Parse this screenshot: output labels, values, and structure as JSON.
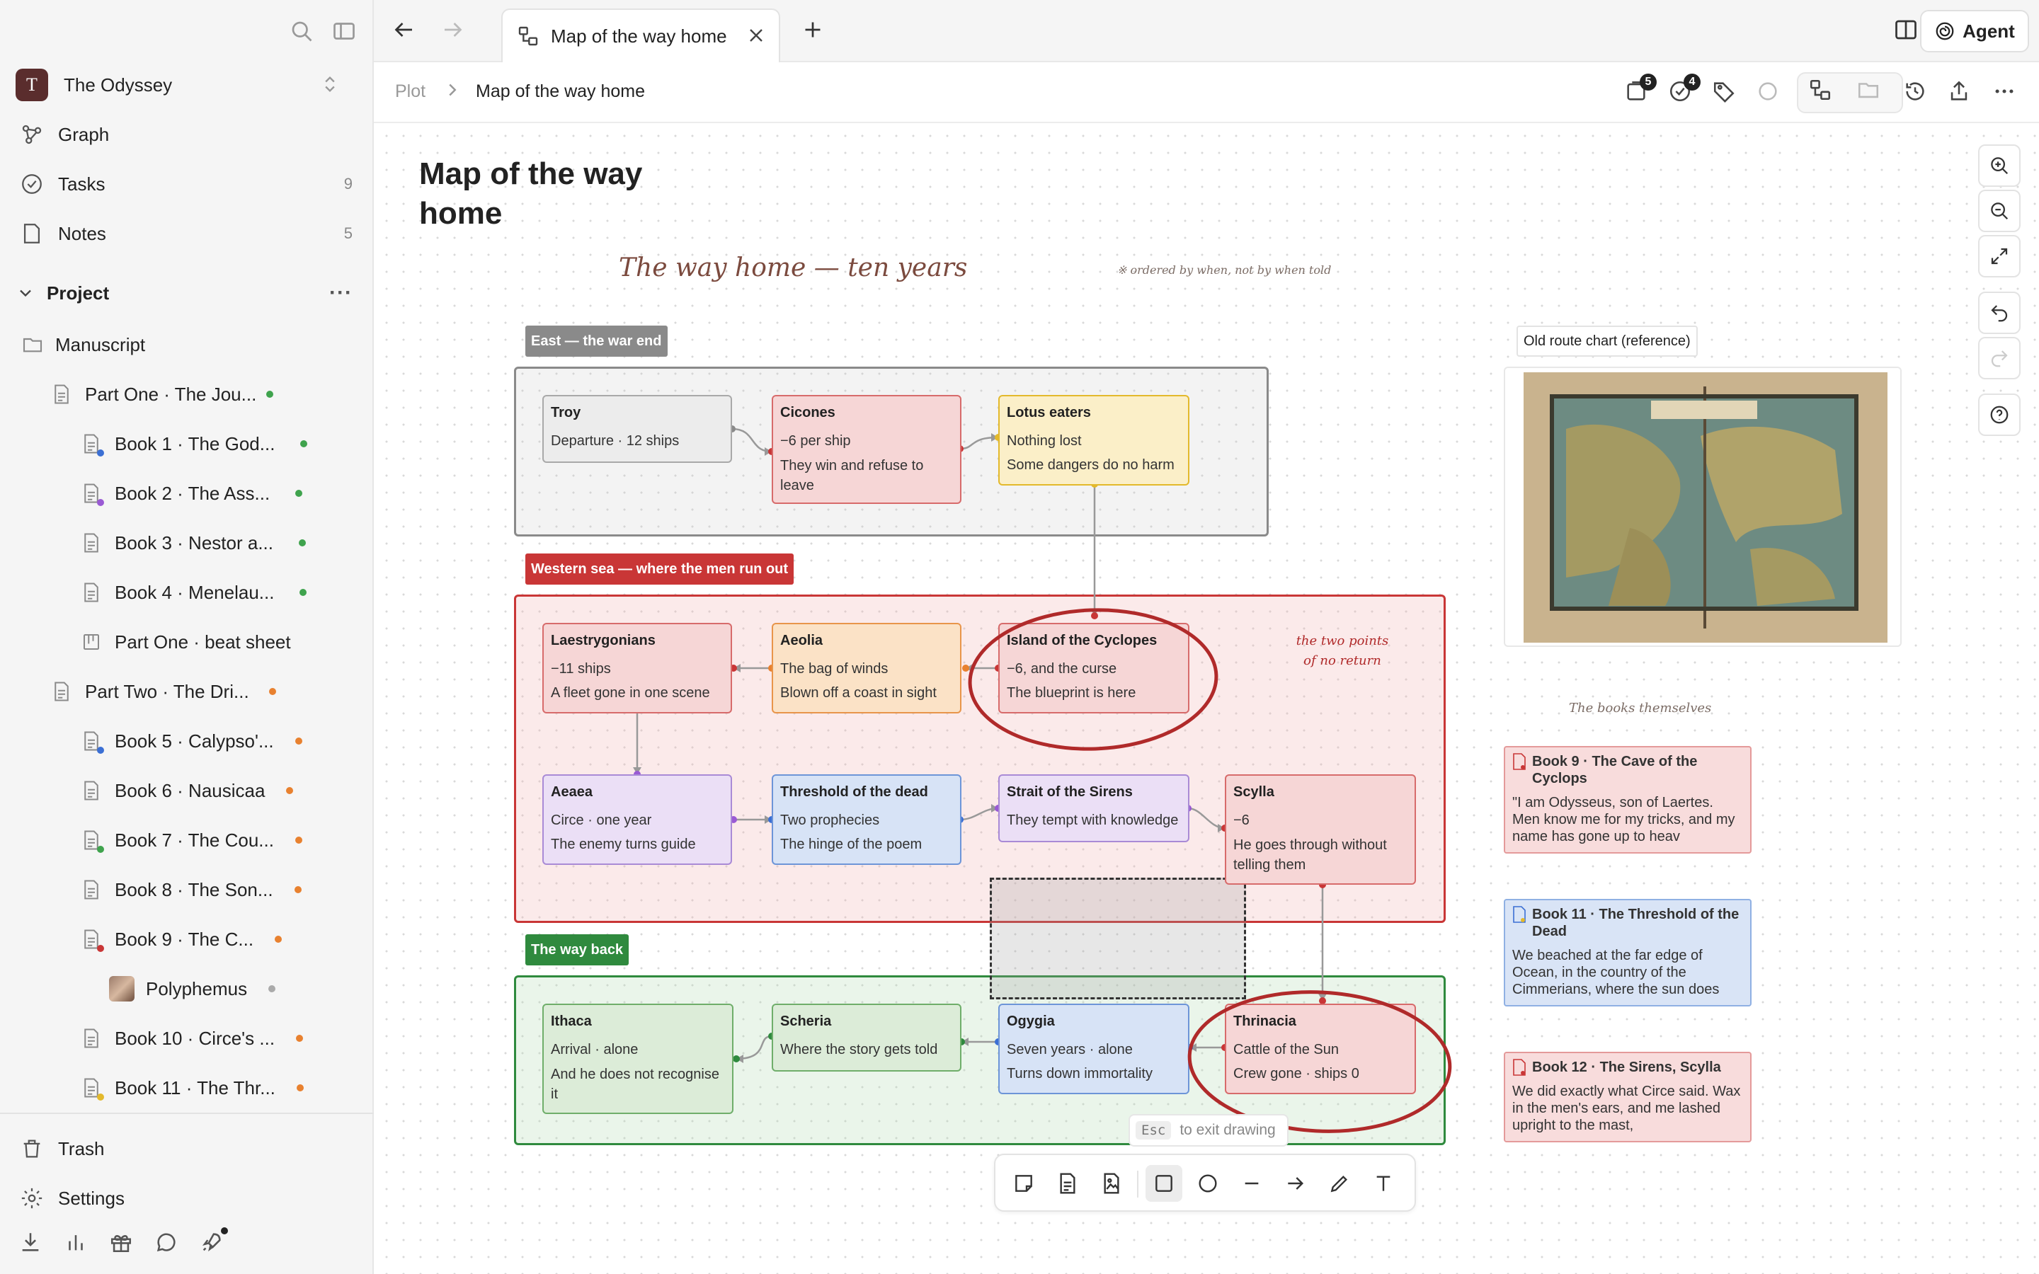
{
  "window": {
    "agent_label": "Agent"
  },
  "tabs": [
    {
      "label": "Map of the way home"
    }
  ],
  "breadcrumb": {
    "parent": "Plot",
    "current": "Map of the way home"
  },
  "badges": {
    "cards": "5",
    "tasks": "4"
  },
  "sidebar": {
    "workspace": {
      "initial": "T",
      "name": "The Odyssey"
    },
    "nav": [
      {
        "label": "Graph",
        "count": ""
      },
      {
        "label": "Tasks",
        "count": "9"
      },
      {
        "label": "Notes",
        "count": "5"
      }
    ],
    "project_label": "Project",
    "tree": [
      {
        "label": "Manuscript"
      },
      {
        "label": "Part One · The Jou...",
        "status": "#3fa34d"
      },
      {
        "label": "Book 1 · The God...",
        "status": "#3fa34d",
        "icon_dot": "#3b6fd4"
      },
      {
        "label": "Book 2 · The Ass...",
        "status": "#3fa34d",
        "icon_dot": "#9a5ad4"
      },
      {
        "label": "Book 3 · Nestor a...",
        "status": "#3fa34d"
      },
      {
        "label": "Book 4 · Menelau...",
        "status": "#3fa34d"
      },
      {
        "label": "Part One · beat sheet"
      },
      {
        "label": "Part Two · The Dri...",
        "status": "#e8812f"
      },
      {
        "label": "Book 5 · Calypso'...",
        "status": "#e8812f",
        "icon_dot": "#3b6fd4"
      },
      {
        "label": "Book 6 · Nausicaa",
        "status": "#e8812f"
      },
      {
        "label": "Book 7 · The Cou...",
        "status": "#e8812f",
        "icon_dot": "#3fa34d"
      },
      {
        "label": "Book 8 · The Son...",
        "status": "#e8812f"
      },
      {
        "label": "Book 9 · The C...",
        "status": "#e8812f",
        "icon_dot": "#c93636"
      },
      {
        "label": "Polyphemus",
        "status": "#aaaaaa"
      },
      {
        "label": "Book 10 · Circe's ...",
        "status": "#e8812f"
      },
      {
        "label": "Book 11 · The Thr...",
        "status": "#e8812f",
        "icon_dot": "#e3b92c"
      }
    ],
    "trash": "Trash",
    "settings": "Settings"
  },
  "canvas": {
    "title": "Map of the way home",
    "handwritten_title": "The way home — ten years",
    "handwritten_note": "※ ordered by when, not by when told",
    "annotation": "the two points of no return",
    "books_note": "The books themselves",
    "image_label": "Old route chart (reference)",
    "groups": [
      {
        "label": "East — the war end",
        "color": "#7a7a7a"
      },
      {
        "label": "Western sea — where the men run out",
        "color": "#c93636"
      },
      {
        "label": "The way back",
        "color": "#2f8a3e"
      }
    ],
    "nodes": [
      {
        "title": "Troy",
        "lines": [
          "Departure · 12 ships"
        ]
      },
      {
        "title": "Cicones",
        "lines": [
          "−6 per ship",
          "They win and refuse to leave"
        ]
      },
      {
        "title": "Lotus eaters",
        "lines": [
          "Nothing lost",
          "Some dangers do no harm"
        ]
      },
      {
        "title": "Laestrygonians",
        "lines": [
          "−11 ships",
          "A fleet gone in one scene"
        ]
      },
      {
        "title": "Aeolia",
        "lines": [
          "The bag of winds",
          "Blown off a coast in sight"
        ]
      },
      {
        "title": "Island of the Cyclopes",
        "lines": [
          "−6, and the curse",
          "The blueprint is here"
        ]
      },
      {
        "title": "Aeaea",
        "lines": [
          "Circe · one year",
          "The enemy turns guide"
        ]
      },
      {
        "title": "Threshold of the dead",
        "lines": [
          "Two prophecies",
          "The hinge of the poem"
        ]
      },
      {
        "title": "Strait of the Sirens",
        "lines": [
          "They tempt with knowledge"
        ]
      },
      {
        "title": "Scylla",
        "lines": [
          "−6",
          "He goes through without telling them"
        ]
      },
      {
        "title": "Ithaca",
        "lines": [
          "Arrival · alone",
          "And he does not recognise it"
        ]
      },
      {
        "title": "Scheria",
        "lines": [
          "Where the story gets told"
        ]
      },
      {
        "title": "Ogygia",
        "lines": [
          "Seven years · alone",
          "Turns down immortality"
        ]
      },
      {
        "title": "Thrinacia",
        "lines": [
          "Cattle of the Sun",
          "Crew gone · ships 0"
        ]
      }
    ],
    "doc_cards": [
      {
        "title": "Book 9 · The Cave of the Cyclops",
        "excerpt": "\"I am Odysseus, son of Laertes. Men know me for my tricks, and my name has gone up to heav"
      },
      {
        "title": "Book 11 · The Threshold of the Dead",
        "excerpt": "We beached at the far edge of Ocean, in the country of the Cimmerians, where the sun does"
      },
      {
        "title": "Book 12 · The Sirens, Scylla",
        "excerpt": "We did exactly what Circe said. Wax in the men's ears, and me lashed upright to the mast,"
      }
    ],
    "esc_key": "Esc",
    "esc_hint": "to exit drawing"
  }
}
